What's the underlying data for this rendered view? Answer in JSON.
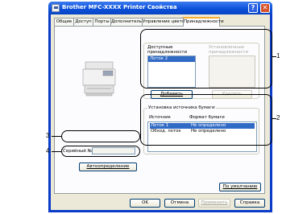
{
  "window": {
    "title": "Brother MFC-XXXX   Printer Свойства",
    "help_label": "?",
    "close_label": "✕"
  },
  "tabs": [
    {
      "label": "Общие"
    },
    {
      "label": "Доступ"
    },
    {
      "label": "Порты"
    },
    {
      "label": "Дополнительно"
    },
    {
      "label": "Управление цветом"
    },
    {
      "label": "Принадлежности"
    }
  ],
  "accessories": {
    "available_title": "Доступные принадлежности",
    "available_items": [
      "Лоток 2"
    ],
    "installed_title": "Установленные принадлежности",
    "add_label": "Добавить",
    "remove_label": "Удалить"
  },
  "paper_source": {
    "title": "Установка источника бумаги",
    "col_source": "Источник",
    "col_format": "Формат бумаги",
    "rows": [
      {
        "source": "Лоток 1",
        "format": "Не определено"
      },
      {
        "source": "Обход. лоток",
        "format": "Не определено"
      }
    ]
  },
  "serial": {
    "label": "Серийный №",
    "value": ""
  },
  "autodetect_label": "Автоопределение",
  "default_label": "По умолчанию",
  "footer": {
    "ok_label": "OK",
    "cancel_label": "Отмена",
    "apply_label": "Применить",
    "help_label": "Справка"
  },
  "callouts": [
    "1",
    "2",
    "3",
    "4"
  ]
}
